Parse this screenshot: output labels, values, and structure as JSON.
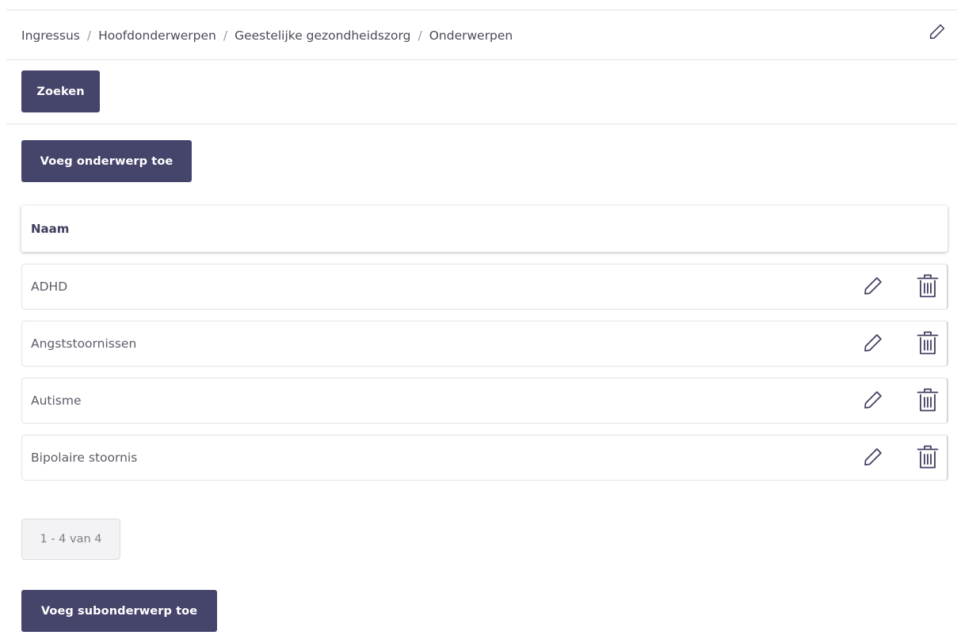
{
  "breadcrumb": {
    "items": [
      "Ingressus",
      "Hoofdonderwerpen",
      "Geestelijke gezondheidszorg",
      "Onderwerpen"
    ],
    "separator": "/"
  },
  "toolbar": {
    "search_label": "Zoeken",
    "add_topic_label": "Voeg onderwerp toe",
    "add_subtopic_label": "Voeg subonderwerp toe"
  },
  "table": {
    "column_name": "Naam",
    "rows": [
      {
        "name": "ADHD"
      },
      {
        "name": "Angststoornissen"
      },
      {
        "name": "Autisme"
      },
      {
        "name": "Bipolaire stoornis"
      }
    ]
  },
  "pagination": {
    "label": "1 - 4 van 4"
  },
  "icons": {
    "edit": "pencil-icon",
    "delete": "trash-icon"
  },
  "colors": {
    "button_bg": "#45446b",
    "button_text": "#ffffff",
    "icon": "#3f3e5f"
  }
}
